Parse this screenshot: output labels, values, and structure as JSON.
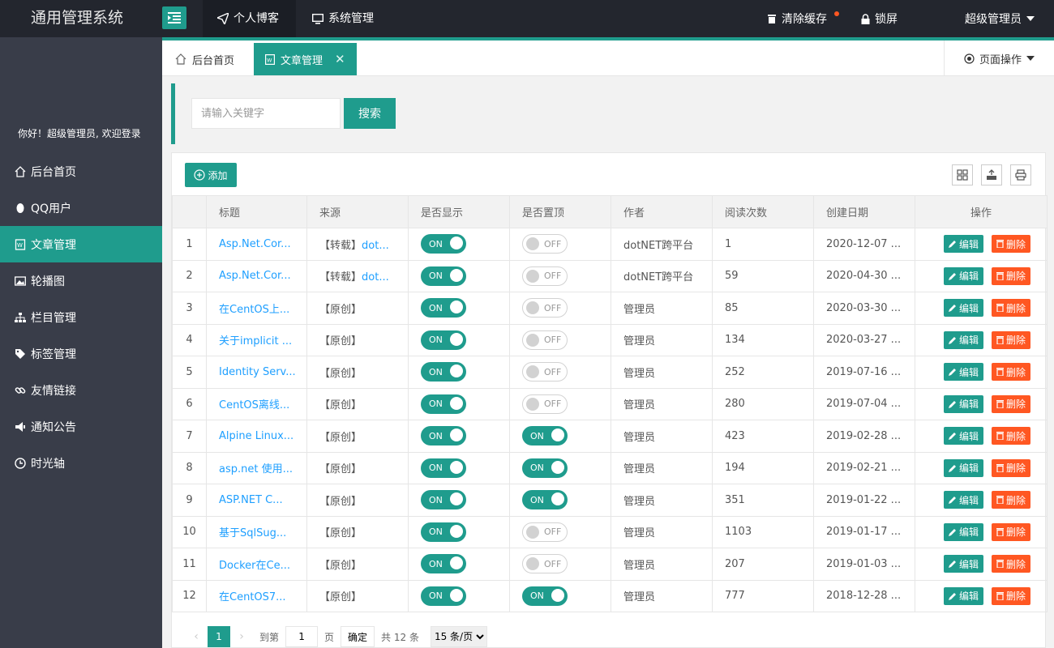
{
  "app": {
    "title": "通用管理系统"
  },
  "header": {
    "nav": [
      {
        "label": "个人博客",
        "icon": "paper-plane-icon",
        "active": true
      },
      {
        "label": "系统管理",
        "icon": "monitor-icon",
        "active": false
      }
    ],
    "clear_cache": "清除缓存",
    "lock": "锁屏",
    "user": "超级管理员"
  },
  "sidebar": {
    "greeting": "你好！超级管理员, 欢迎登录",
    "items": [
      {
        "label": "后台首页",
        "icon": "home-icon"
      },
      {
        "label": "QQ用户",
        "icon": "qq-icon"
      },
      {
        "label": "文章管理",
        "icon": "article-icon",
        "active": true
      },
      {
        "label": "轮播图",
        "icon": "image-icon"
      },
      {
        "label": "栏目管理",
        "icon": "sitemap-icon"
      },
      {
        "label": "标签管理",
        "icon": "tag-icon"
      },
      {
        "label": "友情链接",
        "icon": "link-icon"
      },
      {
        "label": "通知公告",
        "icon": "megaphone-icon"
      },
      {
        "label": "时光轴",
        "icon": "clock-icon"
      }
    ]
  },
  "tabs": {
    "items": [
      {
        "label": "后台首页",
        "icon": "home-icon"
      },
      {
        "label": "文章管理",
        "icon": "article-icon",
        "active": true
      }
    ],
    "page_ops": "页面操作"
  },
  "search": {
    "placeholder": "请输入关键字",
    "button": "搜索"
  },
  "toolbar": {
    "add": "添加"
  },
  "table": {
    "columns": [
      "",
      "标题",
      "来源",
      "是否显示",
      "是否置顶",
      "作者",
      "阅读次数",
      "创建日期",
      "操作"
    ],
    "switch_on": "ON",
    "switch_off": "OFF",
    "edit_label": "编辑",
    "delete_label": "删除",
    "rows": [
      {
        "no": "1",
        "title": "Asp.Net.Cor...",
        "source": "【转载】",
        "source_link": "dot...",
        "show": true,
        "top": false,
        "author": "dotNET跨平台",
        "reads": "1",
        "date": "2020-12-07 ..."
      },
      {
        "no": "2",
        "title": "Asp.Net.Cor...",
        "source": "【转载】",
        "source_link": "dot...",
        "show": true,
        "top": false,
        "author": "dotNET跨平台",
        "reads": "59",
        "date": "2020-04-30 ..."
      },
      {
        "no": "3",
        "title": "在CentOS上...",
        "source": "【原创】",
        "source_link": "",
        "show": true,
        "top": false,
        "author": "管理员",
        "reads": "85",
        "date": "2020-03-30 ..."
      },
      {
        "no": "4",
        "title": "关于implicit ...",
        "source": "【原创】",
        "source_link": "",
        "show": true,
        "top": false,
        "author": "管理员",
        "reads": "134",
        "date": "2020-03-27 ..."
      },
      {
        "no": "5",
        "title": "Identity Serv...",
        "source": "【原创】",
        "source_link": "",
        "show": true,
        "top": false,
        "author": "管理员",
        "reads": "252",
        "date": "2019-07-16 ..."
      },
      {
        "no": "6",
        "title": "CentOS离线...",
        "source": "【原创】",
        "source_link": "",
        "show": true,
        "top": false,
        "author": "管理员",
        "reads": "280",
        "date": "2019-07-04 ..."
      },
      {
        "no": "7",
        "title": "Alpine Linux...",
        "source": "【原创】",
        "source_link": "",
        "show": true,
        "top": true,
        "author": "管理员",
        "reads": "423",
        "date": "2019-02-28 ..."
      },
      {
        "no": "8",
        "title": "asp.net 使用...",
        "source": "【原创】",
        "source_link": "",
        "show": true,
        "top": true,
        "author": "管理员",
        "reads": "194",
        "date": "2019-02-21 ..."
      },
      {
        "no": "9",
        "title": "ASP.NET C...",
        "source": "【原创】",
        "source_link": "",
        "show": true,
        "top": true,
        "author": "管理员",
        "reads": "351",
        "date": "2019-01-22 ..."
      },
      {
        "no": "10",
        "title": "基于SqlSug...",
        "source": "【原创】",
        "source_link": "",
        "show": true,
        "top": false,
        "author": "管理员",
        "reads": "1103",
        "date": "2019-01-17 ..."
      },
      {
        "no": "11",
        "title": "Docker在Ce...",
        "source": "【原创】",
        "source_link": "",
        "show": true,
        "top": false,
        "author": "管理员",
        "reads": "207",
        "date": "2019-01-03 ..."
      },
      {
        "no": "12",
        "title": "在CentOS7...",
        "source": "【原创】",
        "source_link": "",
        "show": true,
        "top": true,
        "author": "管理员",
        "reads": "777",
        "date": "2018-12-28 ..."
      }
    ]
  },
  "pager": {
    "current": "1",
    "goto_prefix": "到第",
    "goto_value": "1",
    "goto_suffix": "页",
    "confirm": "确定",
    "total": "共 12 条",
    "page_size": "15 条/页"
  },
  "colors": {
    "accent": "#1f9c8d",
    "danger": "#ff5722",
    "link": "#1e9fff",
    "header": "#23262e",
    "sidebar": "#393d49"
  }
}
